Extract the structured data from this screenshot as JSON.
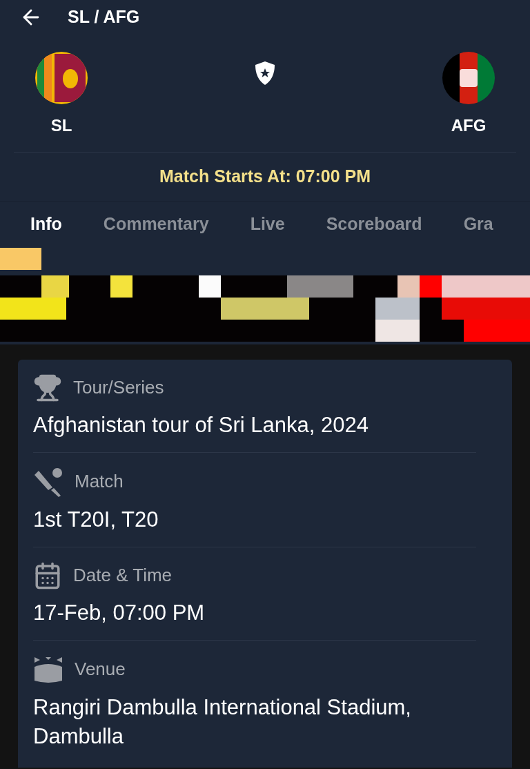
{
  "header": {
    "title": "SL / AFG"
  },
  "teams": [
    {
      "name": "SL"
    },
    {
      "name": "AFG"
    }
  ],
  "match_start": "Match Starts At: 07:00 PM",
  "tabs": [
    {
      "label": "Info",
      "selected": true
    },
    {
      "label": "Commentary",
      "selected": false
    },
    {
      "label": "Live",
      "selected": false
    },
    {
      "label": "Scoreboard",
      "selected": false
    },
    {
      "label": "Gra",
      "selected": false
    }
  ],
  "info": [
    {
      "kind": "trophy",
      "label": "Tour/Series",
      "value": "Afghanistan tour of Sri Lanka, 2024"
    },
    {
      "kind": "bat",
      "label": "Match",
      "value": "1st T20I, T20"
    },
    {
      "kind": "calendar",
      "label": "Date & Time",
      "value": "17-Feb, 07:00 PM"
    },
    {
      "kind": "stadium",
      "label": "Venue",
      "value": "Rangiri Dambulla International Stadium, Dambulla"
    }
  ]
}
